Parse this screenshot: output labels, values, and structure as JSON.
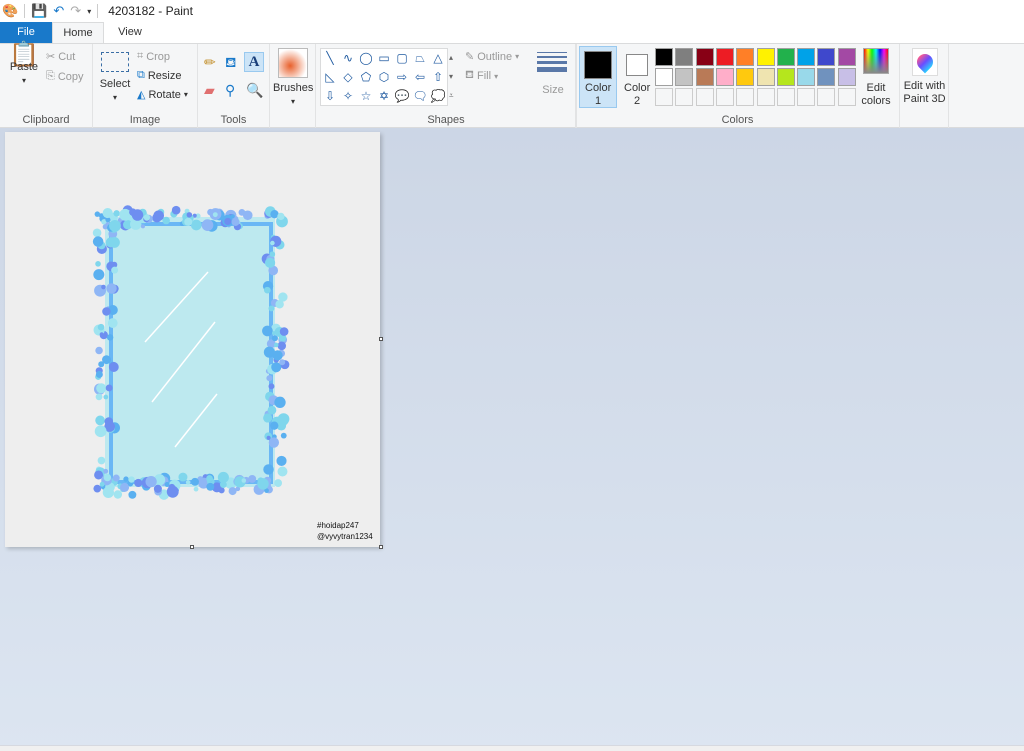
{
  "title": "4203182 - Paint",
  "tabs": [
    "File",
    "Home",
    "View"
  ],
  "clipboard": {
    "paste": "Paste",
    "cut": "Cut",
    "copy": "Copy",
    "label": "Clipboard"
  },
  "image": {
    "select": "Select",
    "crop": "Crop",
    "resize": "Resize",
    "rotate": "Rotate",
    "label": "Image"
  },
  "tools": {
    "label": "Tools"
  },
  "brushes": {
    "label": "Brushes"
  },
  "shapes": {
    "label": "Shapes",
    "outline": "Outline",
    "fill": "Fill",
    "glyphs": [
      "╲",
      "∿",
      "◯",
      "▭",
      "▢",
      "⏢",
      "△",
      "◺",
      "◇",
      "⬠",
      "⬡",
      "⇨",
      "⇦",
      "⇧",
      "⇩",
      "✧",
      "☆",
      "✡",
      "💬",
      "🗨",
      "💭"
    ]
  },
  "size": {
    "label": "Size"
  },
  "colors": {
    "label": "Colors",
    "color1": "Color 1",
    "color2": "Color 2",
    "edit": "Edit colors",
    "color1_value": "#000000",
    "color2_value": "#ffffff",
    "palette": [
      "#000000",
      "#7f7f7f",
      "#880015",
      "#ed1c24",
      "#ff7f27",
      "#fff200",
      "#22b14c",
      "#00a2e8",
      "#3f48cc",
      "#a349a4",
      "#ffffff",
      "#c3c3c3",
      "#b97a57",
      "#ffaec9",
      "#ffc90e",
      "#efe4b0",
      "#b5e61d",
      "#99d9ea",
      "#7092be",
      "#c8bfe7"
    ]
  },
  "paint3d": "Edit with Paint 3D",
  "canvas": {
    "watermark1": "#hoidap247",
    "watermark2": "@vyvytran1234"
  }
}
